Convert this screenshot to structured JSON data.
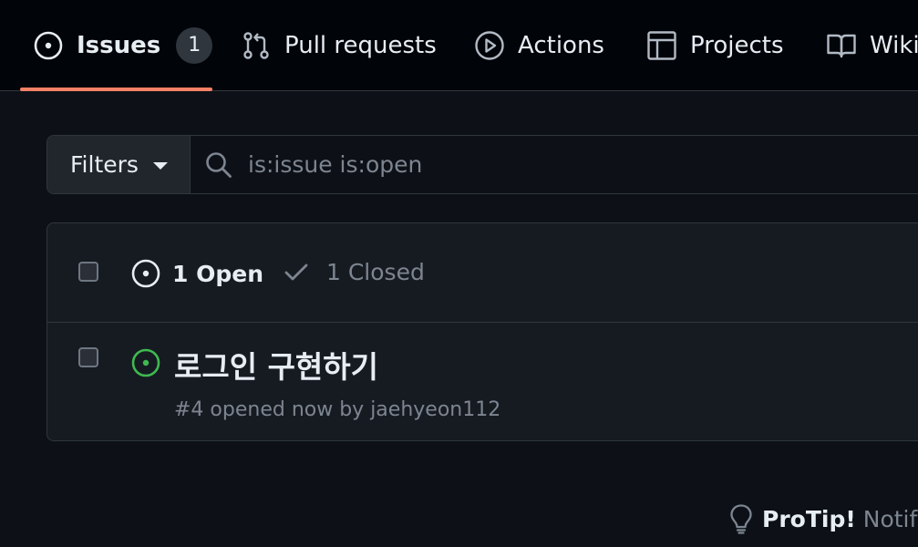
{
  "nav": {
    "tabs": [
      {
        "label": "Issues",
        "icon": "issue-opened-icon",
        "counter": "1",
        "selected": true
      },
      {
        "label": "Pull requests",
        "icon": "git-pull-request-icon"
      },
      {
        "label": "Actions",
        "icon": "play-icon"
      },
      {
        "label": "Projects",
        "icon": "table-icon"
      },
      {
        "label": "Wiki",
        "icon": "book-icon"
      }
    ],
    "accent_color": "#f78166"
  },
  "filters": {
    "button_label": "Filters",
    "search_value": "",
    "search_placeholder": "is:issue is:open"
  },
  "issues_header": {
    "open_label": "1 Open",
    "closed_label": "1 Closed"
  },
  "issues": [
    {
      "title": "로그인 구현하기",
      "meta": "#4 opened now by jaehyeon112",
      "status_color": "#3fb950"
    }
  ],
  "protip": {
    "strong": "ProTip!",
    "text": "Notify"
  }
}
